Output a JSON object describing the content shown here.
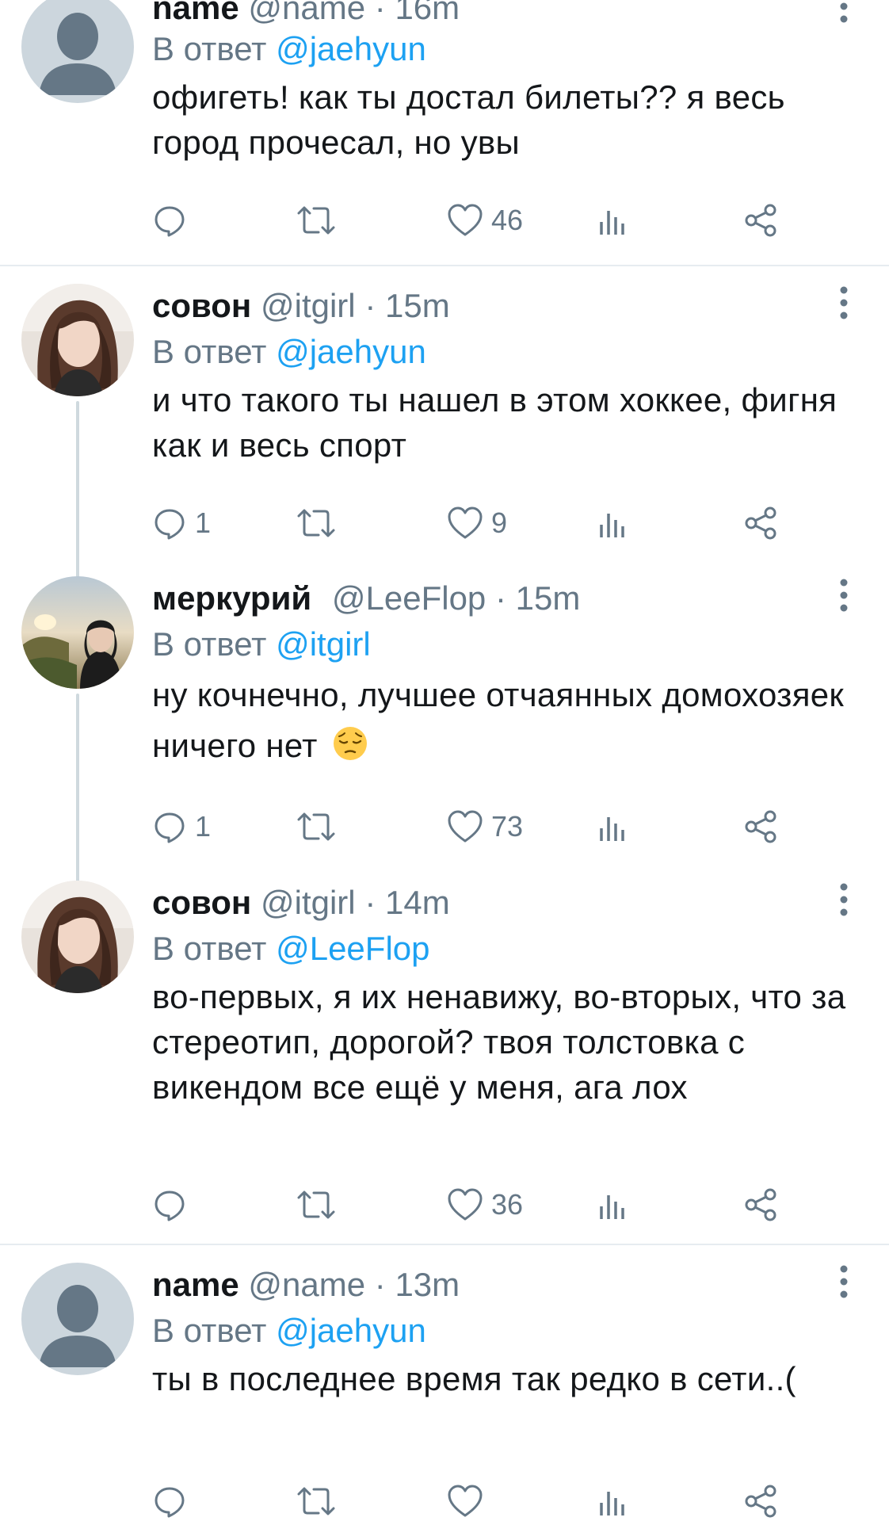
{
  "tweets": [
    {
      "name": "name",
      "handle": "@name",
      "dot": "·",
      "time": "16m",
      "reply_prefix": "В ответ",
      "reply_mention": "@jaehyun",
      "text": "офигеть! как ты достал билеты?? я весь город прочесал, но увы",
      "replies": "",
      "retweets": "",
      "likes": "46",
      "avatar": "default-avatar"
    },
    {
      "name": "совон",
      "handle": "@itgirl",
      "dot": "·",
      "time": "15m",
      "reply_prefix": "В ответ",
      "reply_mention": "@jaehyun",
      "text": "и что такого ты нашел в этом хоккее, фигня как и весь спорт",
      "replies": "1",
      "retweets": "",
      "likes": "9",
      "avatar": "photo-girl-long-hair"
    },
    {
      "name": "меркурий",
      "handle": "@LeeFlop",
      "dot": "·",
      "time": "15m",
      "reply_prefix": "В ответ",
      "reply_mention": "@itgirl",
      "text": "ну кочнечно, лучшее отчаянных домохозяек ничего нет",
      "emoji": "pensive-face",
      "replies": "1",
      "retweets": "",
      "likes": "73",
      "avatar": "photo-sunset-person"
    },
    {
      "name": "совон",
      "handle": "@itgirl",
      "dot": "·",
      "time": "14m",
      "reply_prefix": "В ответ",
      "reply_mention": "@LeeFlop",
      "text": "во-первых, я их ненавижу, во-вторых, что за стереотип, дорогой? твоя толстовка с викендом все ещё у меня, ага лох",
      "replies": "",
      "retweets": "",
      "likes": "36",
      "avatar": "photo-girl-long-hair"
    },
    {
      "name": "name",
      "handle": "@name",
      "dot": "·",
      "time": "13m",
      "reply_prefix": "В ответ",
      "reply_mention": "@jaehyun",
      "text": "ты в последнее время так редко в сети..(",
      "replies": "",
      "retweets": "",
      "likes": "",
      "avatar": "default-avatar"
    }
  ],
  "colors": {
    "text": "#14171a",
    "secondary": "#657786",
    "link": "#1da1f2",
    "divider": "#e6ecf0"
  }
}
